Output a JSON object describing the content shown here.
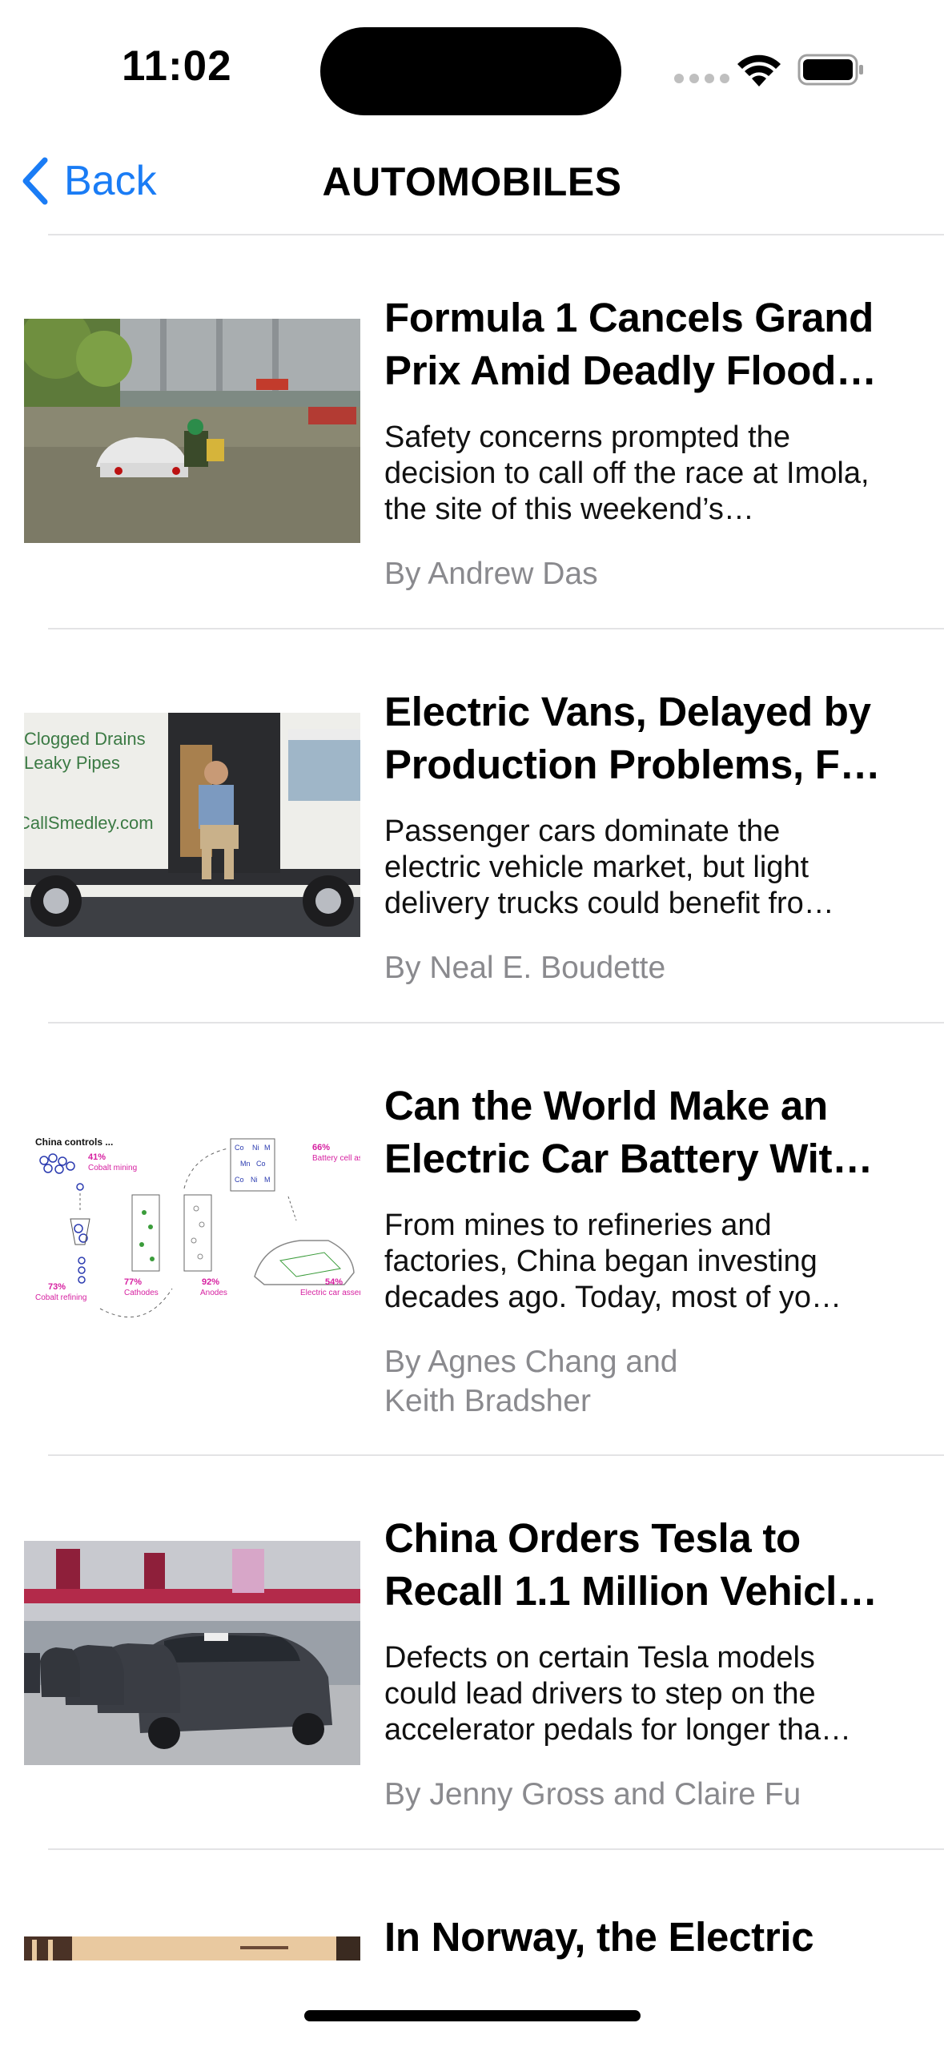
{
  "status_bar": {
    "time": "11:02"
  },
  "nav": {
    "back_label": "Back",
    "title": "AUTOMOBILES"
  },
  "articles": [
    {
      "title": "Formula 1 Cancels Grand Prix Amid Deadly Flood…",
      "summary": "Safety concerns prompted the decision to call off the race at Imola, the site of this weekend’s…",
      "byline": "By Andrew Das",
      "image": "flooded-street-car-photo"
    },
    {
      "title": "Electric Vans, Delayed by Production Problems, F…",
      "summary": "Passenger cars dominate the electric vehicle market, but light delivery trucks could benefit fro…",
      "byline": "By Neal E. Boudette",
      "image": "delivery-van-photo",
      "image_text": {
        "line1": "Clogged Drains",
        "line2": "Leaky Pipes",
        "line3": "CallSmedley.com"
      }
    },
    {
      "title": "Can the World Make an Electric Car Battery Wit…",
      "summary": "From mines to refineries and factories, China began investing decades ago. Today, most of yo…",
      "byline": "By Agnes Chang and Keith Bradsher",
      "image": "battery-supply-chain-graphic",
      "graphic": {
        "heading": "China controls ...",
        "stats": [
          {
            "value": "41%",
            "label": "Cobalt mining"
          },
          {
            "value": "73%",
            "label": "Cobalt refining"
          },
          {
            "value": "77%",
            "label": "Cathodes"
          },
          {
            "value": "92%",
            "label": "Anodes"
          },
          {
            "value": "66%",
            "label": "Battery cell assembly"
          },
          {
            "value": "54%",
            "label": "Electric car assembly"
          }
        ]
      }
    },
    {
      "title": "China Orders Tesla to Recall 1.1 Million Vehicl…",
      "summary": "Defects on certain Tesla models could lead drivers to step on the accelerator pedals for longer tha…",
      "byline": "By Jenny Gross and Claire Fu",
      "image": "tesla-factory-line-photo"
    },
    {
      "title": "In Norway, the Electric",
      "image": "norway-street-photo"
    }
  ],
  "colors": {
    "accent": "#1a7cf5",
    "byline": "#8a8a8e",
    "separator": "#e3e3e5"
  }
}
